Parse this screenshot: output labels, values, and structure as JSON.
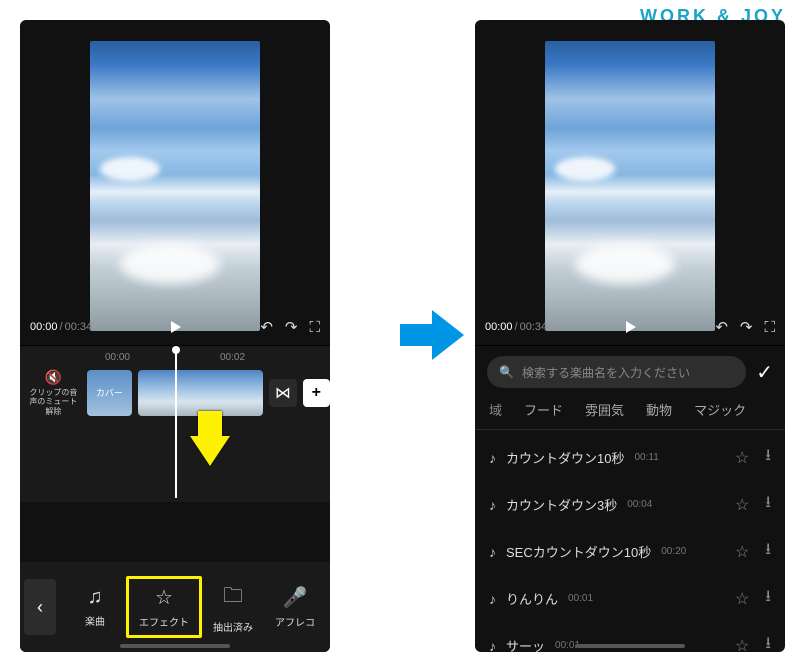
{
  "watermark": "WORK & JOY",
  "player": {
    "current": "00:00",
    "total": "00:34"
  },
  "timeline": {
    "marks": [
      "00:00",
      "00:02"
    ],
    "mute_label": "クリップの音声のミュート解除",
    "cover_label": "カバー"
  },
  "tabs": {
    "music": "楽曲",
    "effect": "エフェクト",
    "extracted": "抽出済み",
    "afreco": "アフレコ"
  },
  "search": {
    "placeholder": "検索する楽曲名を入力ください"
  },
  "categories": [
    "域",
    "フード",
    "雰囲気",
    "動物",
    "マジック"
  ],
  "tracks": [
    {
      "name": "カウントダウン10秒",
      "duration": "00:11"
    },
    {
      "name": "カウントダウン3秒",
      "duration": "00:04"
    },
    {
      "name": "SECカウントダウン10秒",
      "duration": "00:20"
    },
    {
      "name": "りんりん",
      "duration": "00:01"
    },
    {
      "name": "サーッ",
      "duration": "00:01"
    }
  ]
}
